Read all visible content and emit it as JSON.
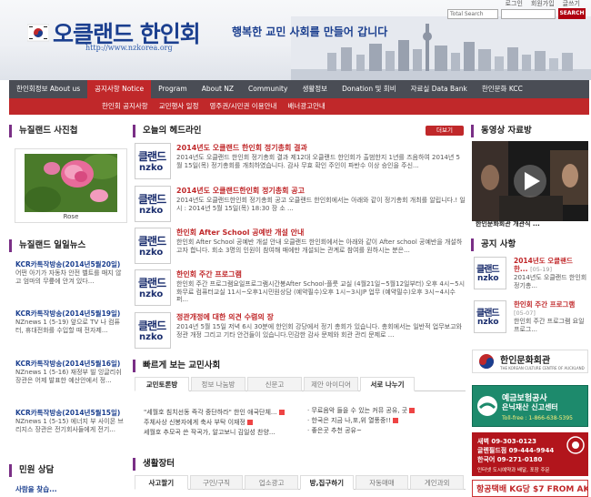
{
  "header": {
    "top_links": [
      "로그인",
      "회원가입",
      "글쓰기"
    ],
    "search_option": "Total Search",
    "search_button": "SEARCH",
    "logo_title": "오클랜드 한인회",
    "logo_url": "http://www.nzkorea.org",
    "slogan": "행복한 교민 사회를 만들어 갑니다"
  },
  "nav": {
    "main": [
      {
        "label": "한인회정보 About us",
        "active": false
      },
      {
        "label": "공지사항 Notice",
        "active": true
      },
      {
        "label": "Program",
        "active": false
      },
      {
        "label": "About NZ",
        "active": false
      },
      {
        "label": "Community",
        "active": false
      },
      {
        "label": "생활정보",
        "active": false
      },
      {
        "label": "Donation 및 회비",
        "active": false
      },
      {
        "label": "자료실 Data Bank",
        "active": false
      },
      {
        "label": "한인문화 KCC",
        "active": false
      }
    ],
    "sub": [
      "한인회 공지사항",
      "교민행사 일정",
      "영주권/시민권 이용안내",
      "배너광고안내"
    ]
  },
  "left": {
    "photo_heading": "뉴질랜드 사진첩",
    "photo_caption": "Rose",
    "news_heading": "뉴질랜드 일일뉴스",
    "news": [
      {
        "title": "KCR카톡작방송(2014년5월20일)",
        "body": "어떤 아기가 자동차 안전 벨트를 매지 않고 엄마의 무릎에 안겨 있다..."
      },
      {
        "title": "KCR카톡작방송(2014년5월19일)",
        "body": "NZnews 1 (5-19) 앞으로 TV 나 컴퓨터, 휴대전화를 수입할 때 전자제..."
      },
      {
        "title": "KCR카톡작방송(2014년5월16일)",
        "body": "NZnews 1 (5-16) 재정부 빌 잉글리쉬 장관은 어제 발표한 예산안에서 정..."
      },
      {
        "title": "KCR카톡작방송(2014년5월15일)",
        "body": "NZnews 1 (5-15) 에너지 부 사이몬 브리지스 장관은 전기회사들에게 전기..."
      }
    ],
    "consult_heading": "민원 상담",
    "consult_first": "사람을 찾습..."
  },
  "middle": {
    "headline_heading": "오늘의 헤드라인",
    "more_label": "더보기",
    "headlines": [
      {
        "title": "2014년도 오클랜드 한인회 정기총회 결과",
        "body": "2014년도 오클랜드 한인회 정기총회 결과 제12대 오클랜드 한인회가 출범한지 1년를 즈음하여 2014년 5월 15일(목) 정기총회를 개최하였습니다. 감사 무효 확인 주인이 파반수 이상 승인을 주신..."
      },
      {
        "title": "2014년도 오클랜드한인회 정기총회 공고",
        "body": "2014년도 오클랜드한인회 정기총회 공고 오클랜드 한인회에서는 아래와 같이 정기총회 개최를 알립니다.! 일 시 : 2014년 5월 15일(목) 18:30 장 소 ..."
      },
      {
        "title": "한인회 After School 공예반 개설 안내",
        "body": "한인회 After School 공예반 개설 안내 오클랜드 한인회에서는 아래와 같이 After school 공예반을 개설하고자 합니다. 회소 3명의 인원이 참여해 매에만 개설되는 관계로 참여를 원하시는 분은..."
      },
      {
        "title": "한인회 주간 프로그램",
        "body": "한인회 주간 프로그램요일프로그램시간봉After School-플룻 교실 (4월21일~5월12일부터) 오후 4시~5시화무료 컴퓨터교실 11시~오후1시민원상담 (예약필수)오후 1시~3시JP 업무 (예약필수)오후 3시~4시수퍼..."
      },
      {
        "title": "정관개정에 대한 의견 수렴의 장",
        "body": "2014년 5월 15일 저녁 6시 30분에 한인회 강당에서 정기 총회가 있습니다. 총회에서는 일반적 업무보고와 정관 개정 그리고 기타 안건들이 있습니다.민감한 감사 문제와 회관 관리 문제로 ..."
      }
    ],
    "bbs_heading": "빠르게 보는 교민사회",
    "bbs_tabs": [
      "교민토론방",
      "정보 나눔방",
      "신문고",
      "제안 아이디어",
      "서로 나누기"
    ],
    "bbs_active_tab": 4,
    "bbs_left": [
      "\"세월호 침치선동 즉각 중단하라\" 한인 애국단체...",
      "주체사상 신봉자에게 축사 부탁 이재정",
      "세월호 추모곡 쓴 작곡가, 알고보니 김일성 찬양..."
    ],
    "bbs_right": [
      "무료음악 들을 수 있는 커뮤 공유, 굿",
      "한국은 지금 나,포,위 열풍중!!",
      "좋은곳 추천 공유~"
    ],
    "life_heading": "생활장터",
    "life_tabs": [
      "사고팔기",
      "구인/구직",
      "업소광고",
      "방,집구하기",
      "자동매매",
      "게인과외"
    ],
    "life_active_tabs": [
      0,
      3
    ]
  },
  "right": {
    "video_heading": "동영상 자료방",
    "video_caption": "한인문화회관 개관식 ...",
    "notice_heading": "공지 사항",
    "notices": [
      {
        "title": "2014년도 오클랜드 한...",
        "date": "[05-19]",
        "body": "2014년도 오클랜드 한인회 정기총..."
      },
      {
        "title": "한인회 주간 프로그램",
        "date": "[05-07]",
        "body": "한인회 주간 프로그램 요일프로그..."
      }
    ],
    "culture_title": "한인문화회관",
    "culture_sub": "THE KOREAN CULTURE CENTRE OF AUCKLAND",
    "deposit_title": "예금보험공사",
    "deposit_sub": "은닉재산 신고센터",
    "deposit_phone": "Toll-free : 1-866-638-5395",
    "church_lines": [
      "새벽  09-303-0123",
      "글렌필드점  09-444-9944",
      "한국어  09-271-0180"
    ],
    "church_note": "인터넷 도시예약과 배달, 포장 주문",
    "courier_text": "항공택배 KG당 $7 FROM AK"
  },
  "thumb_logo": {
    "line1": "클랜드",
    "line2": "nzko"
  },
  "colors": {
    "accent_red": "#c0282a",
    "nav_dark": "#4a4d55",
    "brand_blue": "#1b3f8f"
  }
}
